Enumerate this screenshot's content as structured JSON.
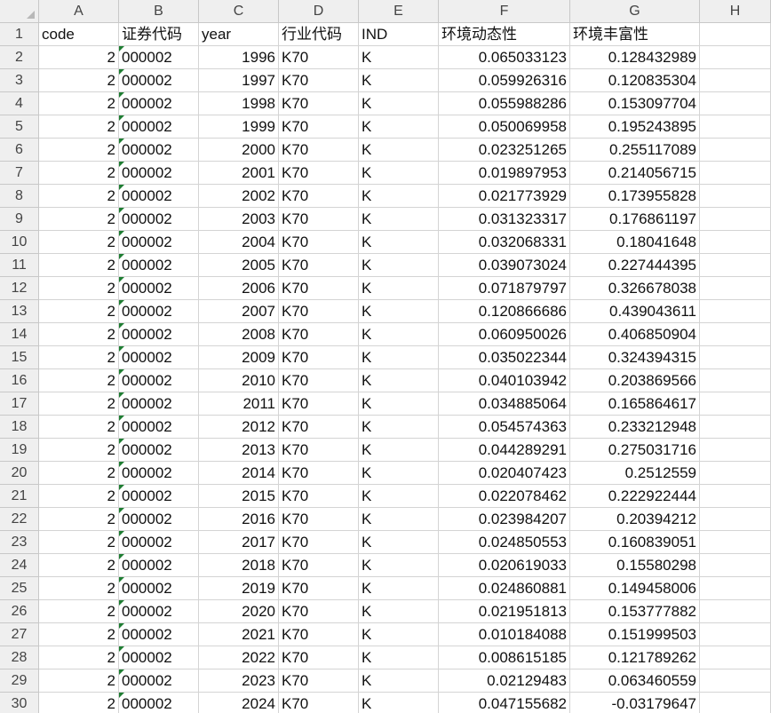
{
  "columns": [
    "A",
    "B",
    "C",
    "D",
    "E",
    "F",
    "G",
    "H"
  ],
  "header_row": {
    "num": "1",
    "cells": [
      "code",
      "证券代码",
      "year",
      "行业代码",
      "IND",
      "环境动态性",
      "环境丰富性",
      ""
    ]
  },
  "rows": [
    {
      "num": "2",
      "code": "2",
      "stock": "000002",
      "year": "1996",
      "indcode": "K70",
      "ind": "K",
      "dyn": "0.065033123",
      "rich": "0.128432989"
    },
    {
      "num": "3",
      "code": "2",
      "stock": "000002",
      "year": "1997",
      "indcode": "K70",
      "ind": "K",
      "dyn": "0.059926316",
      "rich": "0.120835304"
    },
    {
      "num": "4",
      "code": "2",
      "stock": "000002",
      "year": "1998",
      "indcode": "K70",
      "ind": "K",
      "dyn": "0.055988286",
      "rich": "0.153097704"
    },
    {
      "num": "5",
      "code": "2",
      "stock": "000002",
      "year": "1999",
      "indcode": "K70",
      "ind": "K",
      "dyn": "0.050069958",
      "rich": "0.195243895"
    },
    {
      "num": "6",
      "code": "2",
      "stock": "000002",
      "year": "2000",
      "indcode": "K70",
      "ind": "K",
      "dyn": "0.023251265",
      "rich": "0.255117089"
    },
    {
      "num": "7",
      "code": "2",
      "stock": "000002",
      "year": "2001",
      "indcode": "K70",
      "ind": "K",
      "dyn": "0.019897953",
      "rich": "0.214056715"
    },
    {
      "num": "8",
      "code": "2",
      "stock": "000002",
      "year": "2002",
      "indcode": "K70",
      "ind": "K",
      "dyn": "0.021773929",
      "rich": "0.173955828"
    },
    {
      "num": "9",
      "code": "2",
      "stock": "000002",
      "year": "2003",
      "indcode": "K70",
      "ind": "K",
      "dyn": "0.031323317",
      "rich": "0.176861197"
    },
    {
      "num": "10",
      "code": "2",
      "stock": "000002",
      "year": "2004",
      "indcode": "K70",
      "ind": "K",
      "dyn": "0.032068331",
      "rich": "0.18041648"
    },
    {
      "num": "11",
      "code": "2",
      "stock": "000002",
      "year": "2005",
      "indcode": "K70",
      "ind": "K",
      "dyn": "0.039073024",
      "rich": "0.227444395"
    },
    {
      "num": "12",
      "code": "2",
      "stock": "000002",
      "year": "2006",
      "indcode": "K70",
      "ind": "K",
      "dyn": "0.071879797",
      "rich": "0.326678038"
    },
    {
      "num": "13",
      "code": "2",
      "stock": "000002",
      "year": "2007",
      "indcode": "K70",
      "ind": "K",
      "dyn": "0.120866686",
      "rich": "0.439043611"
    },
    {
      "num": "14",
      "code": "2",
      "stock": "000002",
      "year": "2008",
      "indcode": "K70",
      "ind": "K",
      "dyn": "0.060950026",
      "rich": "0.406850904"
    },
    {
      "num": "15",
      "code": "2",
      "stock": "000002",
      "year": "2009",
      "indcode": "K70",
      "ind": "K",
      "dyn": "0.035022344",
      "rich": "0.324394315"
    },
    {
      "num": "16",
      "code": "2",
      "stock": "000002",
      "year": "2010",
      "indcode": "K70",
      "ind": "K",
      "dyn": "0.040103942",
      "rich": "0.203869566"
    },
    {
      "num": "17",
      "code": "2",
      "stock": "000002",
      "year": "2011",
      "indcode": "K70",
      "ind": "K",
      "dyn": "0.034885064",
      "rich": "0.165864617"
    },
    {
      "num": "18",
      "code": "2",
      "stock": "000002",
      "year": "2012",
      "indcode": "K70",
      "ind": "K",
      "dyn": "0.054574363",
      "rich": "0.233212948"
    },
    {
      "num": "19",
      "code": "2",
      "stock": "000002",
      "year": "2013",
      "indcode": "K70",
      "ind": "K",
      "dyn": "0.044289291",
      "rich": "0.275031716"
    },
    {
      "num": "20",
      "code": "2",
      "stock": "000002",
      "year": "2014",
      "indcode": "K70",
      "ind": "K",
      "dyn": "0.020407423",
      "rich": "0.2512559"
    },
    {
      "num": "21",
      "code": "2",
      "stock": "000002",
      "year": "2015",
      "indcode": "K70",
      "ind": "K",
      "dyn": "0.022078462",
      "rich": "0.222922444"
    },
    {
      "num": "22",
      "code": "2",
      "stock": "000002",
      "year": "2016",
      "indcode": "K70",
      "ind": "K",
      "dyn": "0.023984207",
      "rich": "0.20394212"
    },
    {
      "num": "23",
      "code": "2",
      "stock": "000002",
      "year": "2017",
      "indcode": "K70",
      "ind": "K",
      "dyn": "0.024850553",
      "rich": "0.160839051"
    },
    {
      "num": "24",
      "code": "2",
      "stock": "000002",
      "year": "2018",
      "indcode": "K70",
      "ind": "K",
      "dyn": "0.020619033",
      "rich": "0.15580298"
    },
    {
      "num": "25",
      "code": "2",
      "stock": "000002",
      "year": "2019",
      "indcode": "K70",
      "ind": "K",
      "dyn": "0.024860881",
      "rich": "0.149458006"
    },
    {
      "num": "26",
      "code": "2",
      "stock": "000002",
      "year": "2020",
      "indcode": "K70",
      "ind": "K",
      "dyn": "0.021951813",
      "rich": "0.153777882"
    },
    {
      "num": "27",
      "code": "2",
      "stock": "000002",
      "year": "2021",
      "indcode": "K70",
      "ind": "K",
      "dyn": "0.010184088",
      "rich": "0.151999503"
    },
    {
      "num": "28",
      "code": "2",
      "stock": "000002",
      "year": "2022",
      "indcode": "K70",
      "ind": "K",
      "dyn": "0.008615185",
      "rich": "0.121789262"
    },
    {
      "num": "29",
      "code": "2",
      "stock": "000002",
      "year": "2023",
      "indcode": "K70",
      "ind": "K",
      "dyn": "0.02129483",
      "rich": "0.063460559"
    },
    {
      "num": "30",
      "code": "2",
      "stock": "000002",
      "year": "2024",
      "indcode": "K70",
      "ind": "K",
      "dyn": "0.047155682",
      "rich": "-0.03179647"
    }
  ],
  "colors": {
    "header_bg": "#efefef",
    "gridline": "#d4d4d4",
    "text_flag": "#1e7d32"
  },
  "icons": {
    "select_all": "select-all-triangle",
    "text_number_flag": "green-corner-triangle"
  }
}
